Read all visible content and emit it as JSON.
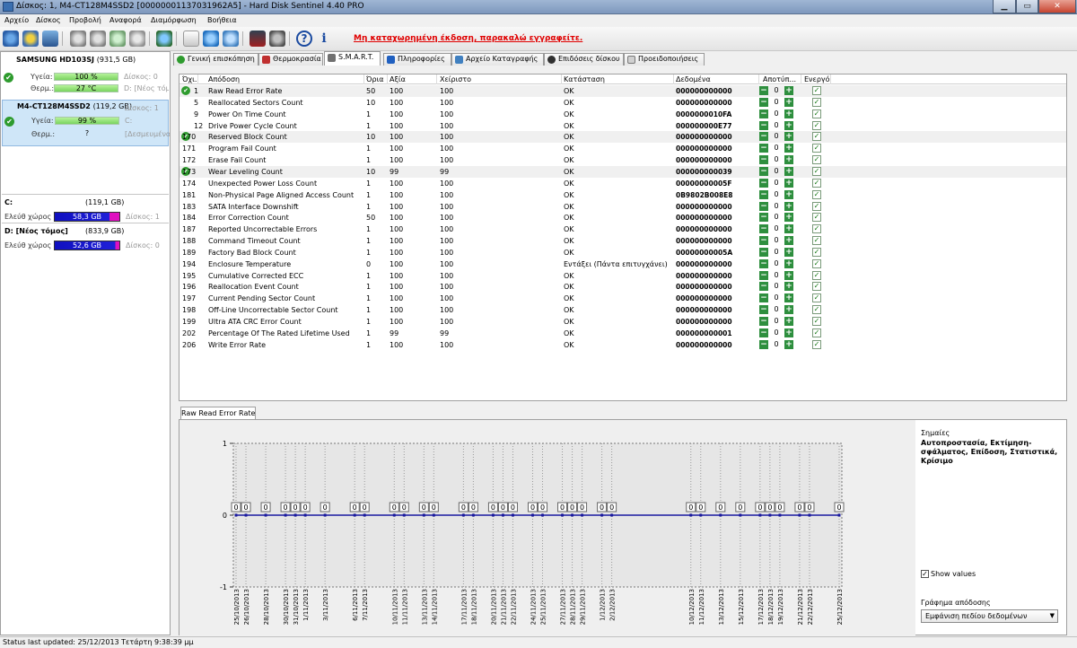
{
  "window": {
    "title": "Δίσκος: 1, M4-CT128M4SSD2 [00000001137031962A5]  -  Hard Disk Sentinel 4.40 PRO"
  },
  "menu": [
    "Αρχείο",
    "Δίσκος",
    "Προβολή",
    "Αναφορά",
    "Διαμόρφωση",
    "Βοήθεια"
  ],
  "toolbar": {
    "unregistered": "Μη καταχωρημένη έκδοση, παρακαλώ εγγραφείτε."
  },
  "disks": [
    {
      "name": "SAMSUNG HD103SJ",
      "size": "(931,5 GB)",
      "health_label": "Υγεία:",
      "health": "100 %",
      "temp_label": "Θερμ.:",
      "temp": "27 °C",
      "right1": "Δίσκος: 0",
      "right2": "D: [Νέος τόμος]"
    },
    {
      "name": "M4-CT128M4SSD2",
      "size": "(119,2 GB)",
      "health_label": "Υγεία:",
      "health": "99 %",
      "temp_label": "Θερμ.:",
      "temp": "?",
      "right1": "Δίσκος: 1",
      "right1b": "C:",
      "right2": "[Δεσμευμένο]"
    }
  ],
  "volumes": [
    {
      "name": "C:",
      "size": "(119,1 GB)",
      "free_label": "Ελεύθ χώρος",
      "free": "58,3 GB",
      "disk": "Δίσκος: 1"
    },
    {
      "name": "D: [Νέος τόμος]",
      "size": "(833,9 GB)",
      "free_label": "Ελεύθ χώρος",
      "free": "52,6 GB",
      "disk": "Δίσκος: 0"
    }
  ],
  "tabs": [
    "Γενική επισκόπηση",
    "Θερμοκρασία",
    "S.M.A.R.T.",
    "Πληροφορίες",
    "Αρχείο Καταγραφής",
    "Επιδόσεις δίσκου",
    "Προειδοποιήσεις"
  ],
  "smart": {
    "headers": [
      "Όχι.",
      "Απόδοση",
      "Όρια",
      "Αξία",
      "Χείριστο",
      "Κατάσταση",
      "Δεδομένα",
      "Αποτύπ...",
      "Ενεργό"
    ],
    "rows": [
      {
        "id": "1",
        "attr": "Raw Read Error Rate",
        "thr": "50",
        "val": "100",
        "worst": "100",
        "status": "OK",
        "data": "000000000000",
        "off": "0",
        "ok": true
      },
      {
        "id": "5",
        "attr": "Reallocated Sectors Count",
        "thr": "10",
        "val": "100",
        "worst": "100",
        "status": "OK",
        "data": "000000000000",
        "off": "0"
      },
      {
        "id": "9",
        "attr": "Power On Time Count",
        "thr": "1",
        "val": "100",
        "worst": "100",
        "status": "OK",
        "data": "0000000010FA",
        "off": "0"
      },
      {
        "id": "12",
        "attr": "Drive Power Cycle Count",
        "thr": "1",
        "val": "100",
        "worst": "100",
        "status": "OK",
        "data": "000000000E77",
        "off": "0"
      },
      {
        "id": "170",
        "attr": "Reserved Block Count",
        "thr": "10",
        "val": "100",
        "worst": "100",
        "status": "OK",
        "data": "000000000000",
        "off": "0",
        "ok": true
      },
      {
        "id": "171",
        "attr": "Program Fail Count",
        "thr": "1",
        "val": "100",
        "worst": "100",
        "status": "OK",
        "data": "000000000000",
        "off": "0"
      },
      {
        "id": "172",
        "attr": "Erase Fail Count",
        "thr": "1",
        "val": "100",
        "worst": "100",
        "status": "OK",
        "data": "000000000000",
        "off": "0"
      },
      {
        "id": "173",
        "attr": "Wear Leveling Count",
        "thr": "10",
        "val": "99",
        "worst": "99",
        "status": "OK",
        "data": "000000000039",
        "off": "0",
        "ok": true
      },
      {
        "id": "174",
        "attr": "Unexpected Power Loss Count",
        "thr": "1",
        "val": "100",
        "worst": "100",
        "status": "OK",
        "data": "00000000005F",
        "off": "0"
      },
      {
        "id": "181",
        "attr": "Non-Physical Page Aligned Access Count",
        "thr": "1",
        "val": "100",
        "worst": "100",
        "status": "OK",
        "data": "0B9802B008E8",
        "off": "0"
      },
      {
        "id": "183",
        "attr": "SATA Interface Downshift",
        "thr": "1",
        "val": "100",
        "worst": "100",
        "status": "OK",
        "data": "000000000000",
        "off": "0"
      },
      {
        "id": "184",
        "attr": "Error Correction Count",
        "thr": "50",
        "val": "100",
        "worst": "100",
        "status": "OK",
        "data": "000000000000",
        "off": "0"
      },
      {
        "id": "187",
        "attr": "Reported Uncorrectable Errors",
        "thr": "1",
        "val": "100",
        "worst": "100",
        "status": "OK",
        "data": "000000000000",
        "off": "0"
      },
      {
        "id": "188",
        "attr": "Command Timeout Count",
        "thr": "1",
        "val": "100",
        "worst": "100",
        "status": "OK",
        "data": "000000000000",
        "off": "0"
      },
      {
        "id": "189",
        "attr": "Factory Bad Block Count",
        "thr": "1",
        "val": "100",
        "worst": "100",
        "status": "OK",
        "data": "00000000005A",
        "off": "0"
      },
      {
        "id": "194",
        "attr": "Enclosure Temperature",
        "thr": "0",
        "val": "100",
        "worst": "100",
        "status": "Εντάξει (Πάντα επιτυγχάνει)",
        "data": "000000000000",
        "off": "0"
      },
      {
        "id": "195",
        "attr": "Cumulative Corrected ECC",
        "thr": "1",
        "val": "100",
        "worst": "100",
        "status": "OK",
        "data": "000000000000",
        "off": "0"
      },
      {
        "id": "196",
        "attr": "Reallocation Event Count",
        "thr": "1",
        "val": "100",
        "worst": "100",
        "status": "OK",
        "data": "000000000000",
        "off": "0"
      },
      {
        "id": "197",
        "attr": "Current Pending Sector Count",
        "thr": "1",
        "val": "100",
        "worst": "100",
        "status": "OK",
        "data": "000000000000",
        "off": "0"
      },
      {
        "id": "198",
        "attr": "Off-Line Uncorrectable Sector Count",
        "thr": "1",
        "val": "100",
        "worst": "100",
        "status": "OK",
        "data": "000000000000",
        "off": "0"
      },
      {
        "id": "199",
        "attr": "Ultra ATA CRC Error Count",
        "thr": "1",
        "val": "100",
        "worst": "100",
        "status": "OK",
        "data": "000000000000",
        "off": "0"
      },
      {
        "id": "202",
        "attr": "Percentage Of The Rated Lifetime Used",
        "thr": "1",
        "val": "99",
        "worst": "99",
        "status": "OK",
        "data": "000000000001",
        "off": "0"
      },
      {
        "id": "206",
        "attr": "Write Error Rate",
        "thr": "1",
        "val": "100",
        "worst": "100",
        "status": "OK",
        "data": "000000000000",
        "off": "0"
      }
    ]
  },
  "graph_tab": "Raw Read Error Rate",
  "chart_data": {
    "type": "line",
    "title": "Raw Read Error Rate",
    "ylim": [
      -1,
      1
    ],
    "yticks": [
      "1",
      "0",
      "-1"
    ],
    "x": [
      "25/10/2013",
      "26/10/2013",
      "28/10/2013",
      "30/10/2013",
      "31/10/2013",
      "1/11/2013",
      "3/11/2013",
      "6/11/2013",
      "7/11/2013",
      "10/11/2013",
      "11/11/2013",
      "13/11/2013",
      "14/11/2013",
      "17/11/2013",
      "18/11/2013",
      "20/11/2013",
      "21/11/2013",
      "22/11/2013",
      "24/11/2013",
      "25/11/2013",
      "27/11/2013",
      "28/11/2013",
      "29/11/2013",
      "1/12/2013",
      "2/12/2013",
      "10/12/2013",
      "11/12/2013",
      "13/12/2013",
      "15/12/2013",
      "17/12/2013",
      "18/12/2013",
      "19/12/2013",
      "21/12/2013",
      "22/12/2013",
      "25/12/2013"
    ],
    "series": [
      {
        "values": [
          0,
          0,
          0,
          0,
          0,
          0,
          0,
          0,
          0,
          0,
          0,
          0,
          0,
          0,
          0,
          0,
          0,
          0,
          0,
          0,
          0,
          0,
          0,
          0,
          0,
          0,
          0,
          0,
          0,
          0,
          0,
          0,
          0,
          0,
          0
        ]
      }
    ],
    "show_values": true,
    "line_color": "#1a1aa0",
    "grid": true
  },
  "graph_side": {
    "legend_title": "Σημαίες",
    "legend_text": "Αυτοπροστασία, Εκτίμηση-σφάλματος, Επίδοση, Στατιστικά, Κρίσιμο",
    "show_values_label": "Show values",
    "perf_label": "Γράφημα απόδοσης",
    "perf_select": "Εμφάνιση πεδίου δεδομένων"
  },
  "status": "Status last updated: 25/12/2013 Τετάρτη 9:38:39 μμ"
}
